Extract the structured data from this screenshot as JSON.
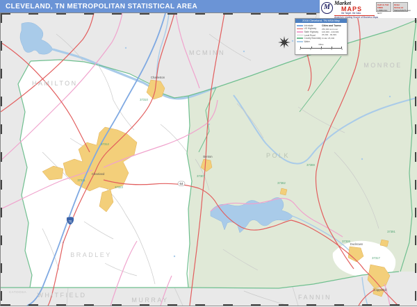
{
  "header": {
    "title": "CLEVELAND, TN METROPOLITAN STATISTICAL AREA"
  },
  "logo": {
    "mark_letter": "M",
    "brand_top": "Market",
    "brand_bottom": "MAPS",
    "tagline": "the Target. the Data.",
    "subtitle": "America's Leading Source of Business Maps",
    "contact_boxes": [
      {
        "line1": "Call Us Toll FREE",
        "line2": "1-888-434-6277"
      },
      {
        "line1": "Order Online At",
        "line2": "MarketMAPS.com"
      }
    ]
  },
  "legend": {
    "title": "2016 Cleveland, TN MSA Map",
    "road_items": [
      {
        "label": "Interstate",
        "color": "#7fa9e2"
      },
      {
        "label": "US Highway",
        "color": "#e25d5d"
      },
      {
        "label": "State Highway",
        "color": "#f0a3cd"
      },
      {
        "label": "Local Road",
        "color": "#c9c9c9"
      },
      {
        "label": "County Boundary",
        "color": "#6fbf8f"
      },
      {
        "label": "Water",
        "color": "#a9cbe9"
      }
    ],
    "cities_header": "Cities and Towns",
    "city_classes": [
      "250,000 and over",
      "100,000 - 249,999",
      "25,000 - 99,999",
      "Under 25,000"
    ],
    "scale_label": "Miles",
    "scale_ticks": [
      "0",
      "2",
      "4",
      "6",
      "8"
    ]
  },
  "map": {
    "counties": [
      {
        "name": "MCMINN"
      },
      {
        "name": "MONROE"
      },
      {
        "name": "HAMILTON"
      },
      {
        "name": "POLK"
      },
      {
        "name": "BRADLEY"
      },
      {
        "name": "WHITFIELD"
      },
      {
        "name": "MURRAY"
      },
      {
        "name": "CATOOSA"
      },
      {
        "name": "FANNIN"
      }
    ],
    "cities": [
      {
        "name": "Cleveland"
      },
      {
        "name": "Charleston"
      },
      {
        "name": "Benton"
      },
      {
        "name": "Ducktown"
      },
      {
        "name": "Copperhill"
      }
    ],
    "zip_codes": [
      "37312",
      "37311",
      "37323",
      "37310",
      "37307",
      "37369",
      "37326",
      "37317",
      "37391",
      "37362"
    ],
    "shields": [
      {
        "label": "75"
      },
      {
        "label": "64"
      }
    ]
  },
  "colors": {
    "header_bar": "#6b94d6",
    "legend_title_bar": "#4d7fc0",
    "brand_red": "#d42a1e",
    "outside_county_fill": "#e9e9e9",
    "forest_fill": "#e0e9d7",
    "water_fill": "#a9cbe9",
    "urban_fill": "#f3cf7a",
    "boundary_green": "#6fbf8f",
    "us_highway_red": "#e25d5d",
    "state_highway_pink": "#f0a3cd",
    "interstate_blue": "#7fa9e2",
    "local_road_gray": "#c9c9c9",
    "county_label": "#c2c2c2"
  }
}
